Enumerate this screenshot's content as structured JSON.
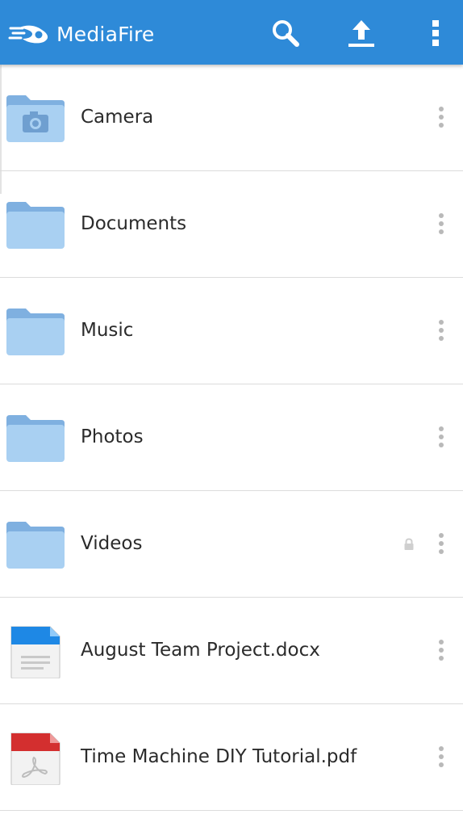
{
  "app": {
    "name": "MediaFire",
    "accent_color": "#2e8ad8",
    "header_icons": [
      "search-icon",
      "upload-icon",
      "overflow-menu-icon"
    ]
  },
  "files": [
    {
      "label": "Camera",
      "icon": "camera-folder-icon",
      "shared": false
    },
    {
      "label": "Documents",
      "icon": "folder-icon",
      "shared": false
    },
    {
      "label": "Music",
      "icon": "folder-icon",
      "shared": false
    },
    {
      "label": "Photos",
      "icon": "folder-icon",
      "shared": false
    },
    {
      "label": "Videos",
      "icon": "folder-icon",
      "shared": true,
      "lock_icon": "lock-icon"
    },
    {
      "label": "August Team Project.docx",
      "icon": "docx-file-icon",
      "shared": false
    },
    {
      "label": "Time Machine DIY Tutorial.pdf",
      "icon": "pdf-file-icon",
      "shared": false
    }
  ],
  "row_menu_icon": "more-vertical-icon"
}
